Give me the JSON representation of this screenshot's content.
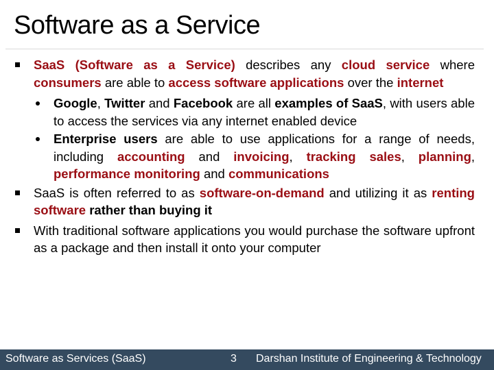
{
  "slide": {
    "title": "Software as a Service",
    "accent_color": "#9a0e14",
    "footer_color": "#344a5f"
  },
  "bullets": [
    {
      "level": 1,
      "marker": "square-bullet",
      "runs": [
        {
          "text": "SaaS (Software as a Service)",
          "style": "accent"
        },
        {
          "text": " describes any ",
          "style": "normal"
        },
        {
          "text": "cloud service",
          "style": "accent"
        },
        {
          "text": " where ",
          "style": "normal"
        },
        {
          "text": "consumers",
          "style": "accent"
        },
        {
          "text": " are able to ",
          "style": "normal"
        },
        {
          "text": "access software applications",
          "style": "accent"
        },
        {
          "text": " over the ",
          "style": "normal"
        },
        {
          "text": "internet",
          "style": "accent"
        }
      ]
    },
    {
      "level": 2,
      "marker": "round-bullet",
      "runs": [
        {
          "text": "Google",
          "style": "bold"
        },
        {
          "text": ", ",
          "style": "normal"
        },
        {
          "text": "Twitter",
          "style": "bold"
        },
        {
          "text": " and ",
          "style": "normal"
        },
        {
          "text": "Facebook",
          "style": "bold"
        },
        {
          "text": " are all ",
          "style": "normal"
        },
        {
          "text": "examples of SaaS",
          "style": "bold"
        },
        {
          "text": ", with users able to access the services via any internet enabled device",
          "style": "normal"
        }
      ]
    },
    {
      "level": 2,
      "marker": "round-bullet",
      "runs": [
        {
          "text": "Enterprise users",
          "style": "bold"
        },
        {
          "text": " are able to use applications for a range of needs, including ",
          "style": "normal"
        },
        {
          "text": "accounting",
          "style": "accent"
        },
        {
          "text": " and ",
          "style": "normal"
        },
        {
          "text": "invoicing",
          "style": "accent"
        },
        {
          "text": ", ",
          "style": "normal"
        },
        {
          "text": "tracking sales",
          "style": "accent"
        },
        {
          "text": ", ",
          "style": "normal"
        },
        {
          "text": "planning",
          "style": "accent"
        },
        {
          "text": ", ",
          "style": "normal"
        },
        {
          "text": "performance monitoring",
          "style": "accent"
        },
        {
          "text": " and ",
          "style": "normal"
        },
        {
          "text": "communications",
          "style": "accent"
        }
      ]
    },
    {
      "level": 1,
      "marker": "square-bullet",
      "runs": [
        {
          "text": "SaaS is often referred to as ",
          "style": "normal"
        },
        {
          "text": "software-on-demand",
          "style": "accent"
        },
        {
          "text": " and utilizing it as ",
          "style": "normal"
        },
        {
          "text": "renting software",
          "style": "accent"
        },
        {
          "text": " rather than buying it",
          "style": "bold"
        }
      ]
    },
    {
      "level": 1,
      "marker": "square-bullet",
      "runs": [
        {
          "text": "With traditional software applications you would purchase the software upfront as a package and then install it onto your computer",
          "style": "normal"
        }
      ]
    }
  ],
  "footer": {
    "left": "Software as Services (SaaS)",
    "page_number": "3",
    "right": "Darshan Institute of Engineering & Technology"
  }
}
